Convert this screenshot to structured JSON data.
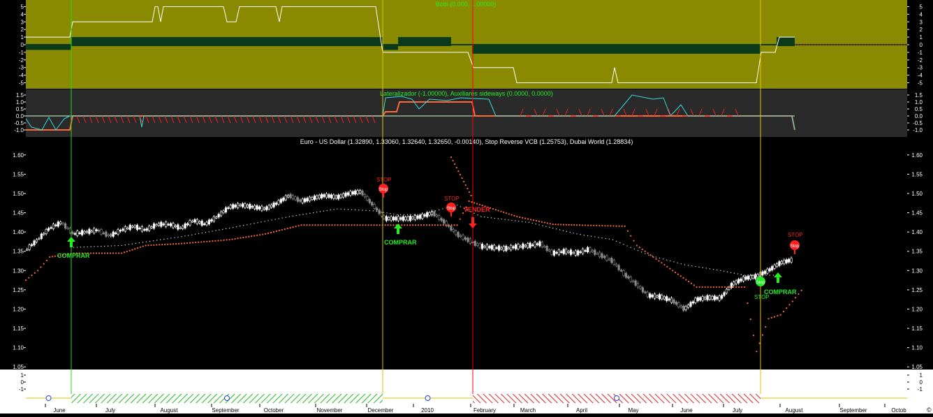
{
  "colors": {
    "upper_bg": "#8a8a00",
    "mid_bg": "#2a2a2a",
    "main_bg": "#000000",
    "white": "#ffffff",
    "green": "#22ee22",
    "red": "#ff2020",
    "orange": "#ff6a3a",
    "cyan": "#33dddd",
    "dark": "#0b3a1a",
    "yellow_line": "#e6c200",
    "green_line": "#22dd22",
    "red_line": "#ff0000"
  },
  "panels": {
    "bobi": {
      "title": "Bobi (0.000, 1.00000)",
      "yticks": [
        "5",
        "4",
        "3",
        "2",
        "1",
        "0",
        "-1",
        "-2",
        "-3",
        "-4",
        "-5"
      ],
      "ylim": [
        -5.5,
        5.5
      ]
    },
    "lateral": {
      "title": "Lateralizador (-1.00000), Auxiliares sideways (0.0000, 0.0000)",
      "yticks": [
        "1.5",
        "1.0",
        "0.5",
        "0.0",
        "-0.5",
        "-1.0"
      ],
      "ylim": [
        -1.4,
        1.8
      ]
    },
    "main": {
      "title": "Euro - US Dollar (1.32890, 1.33060, 1.32640, 1.32650, -0.00140), Stop Reverse VCB (1.25753), Dubai World (1.28834)",
      "yticks": [
        "1.60",
        "1.55",
        "1.50",
        "1.45",
        "1.40",
        "1.35",
        "1.30",
        "1.25",
        "1.20",
        "1.15",
        "1.10",
        "1.05"
      ],
      "ylim": [
        1.045,
        1.645
      ]
    },
    "bottom": {
      "yticks": [
        "1",
        "0",
        "-1"
      ],
      "ylim": [
        -1.5,
        1.6
      ]
    }
  },
  "x_axis": {
    "months": [
      "June",
      "July",
      "August",
      "September",
      "October",
      "November",
      "December",
      "2010",
      "February",
      "March",
      "April",
      "May",
      "June",
      "July",
      "August",
      "September",
      "Octob"
    ],
    "corner_icon": "copyright-icon"
  },
  "signals": {
    "buy1": "COMPRAR",
    "buy2": "COMPRAR",
    "buy3": "COMPRAR",
    "sell": "VENDER",
    "stop1": "STOP",
    "stop2": "STOP",
    "stop3": "STOP",
    "stop4": "STOP",
    "stop_badge": "Stop"
  },
  "regime_bar": [
    {
      "state": "neutral",
      "icon": "smiley-icon"
    },
    {
      "state": "long",
      "icon": "smiley-icon"
    },
    {
      "state": "neutral",
      "icon": "smiley-icon"
    },
    {
      "state": "short",
      "icon": "smiley-icon"
    },
    {
      "state": "neutral",
      "icon": "none"
    }
  ],
  "chart_data": {
    "type": "line",
    "title": "Euro - US Dollar (1.32890, 1.33060, 1.32640, 1.32650, -0.00140), Stop Reverse VCB (1.25753), Dubai World (1.28834)",
    "x_start": "2009-05-18",
    "x_end": "2010-10-15",
    "ylim": [
      1.045,
      1.645
    ],
    "series": [
      {
        "name": "Euro - US Dollar",
        "points": [
          [
            "2009-05-18",
            1.352
          ],
          [
            "2009-05-25",
            1.38
          ],
          [
            "2009-06-01",
            1.41
          ],
          [
            "2009-06-08",
            1.425
          ],
          [
            "2009-06-15",
            1.395
          ],
          [
            "2009-06-22",
            1.4
          ],
          [
            "2009-06-29",
            1.405
          ],
          [
            "2009-07-06",
            1.39
          ],
          [
            "2009-07-13",
            1.405
          ],
          [
            "2009-07-20",
            1.415
          ],
          [
            "2009-07-27",
            1.405
          ],
          [
            "2009-08-03",
            1.42
          ],
          [
            "2009-08-10",
            1.42
          ],
          [
            "2009-08-17",
            1.41
          ],
          [
            "2009-08-24",
            1.43
          ],
          [
            "2009-08-31",
            1.42
          ],
          [
            "2009-09-07",
            1.44
          ],
          [
            "2009-09-14",
            1.465
          ],
          [
            "2009-09-21",
            1.47
          ],
          [
            "2009-09-28",
            1.465
          ],
          [
            "2009-10-05",
            1.46
          ],
          [
            "2009-10-12",
            1.475
          ],
          [
            "2009-10-19",
            1.495
          ],
          [
            "2009-10-26",
            1.48
          ],
          [
            "2009-11-02",
            1.488
          ],
          [
            "2009-11-09",
            1.495
          ],
          [
            "2009-11-16",
            1.49
          ],
          [
            "2009-11-23",
            1.5
          ],
          [
            "2009-11-30",
            1.505
          ],
          [
            "2009-12-07",
            1.47
          ],
          [
            "2009-12-14",
            1.435
          ],
          [
            "2009-12-21",
            1.435
          ],
          [
            "2009-12-28",
            1.435
          ],
          [
            "2010-01-04",
            1.44
          ],
          [
            "2010-01-11",
            1.45
          ],
          [
            "2010-01-18",
            1.425
          ],
          [
            "2010-01-25",
            1.395
          ],
          [
            "2010-02-01",
            1.378
          ],
          [
            "2010-02-08",
            1.363
          ],
          [
            "2010-02-15",
            1.36
          ],
          [
            "2010-02-22",
            1.357
          ],
          [
            "2010-03-01",
            1.362
          ],
          [
            "2010-03-08",
            1.365
          ],
          [
            "2010-03-15",
            1.37
          ],
          [
            "2010-03-22",
            1.345
          ],
          [
            "2010-03-29",
            1.35
          ],
          [
            "2010-04-05",
            1.345
          ],
          [
            "2010-04-12",
            1.355
          ],
          [
            "2010-04-19",
            1.34
          ],
          [
            "2010-04-26",
            1.325
          ],
          [
            "2010-05-03",
            1.29
          ],
          [
            "2010-05-10",
            1.265
          ],
          [
            "2010-05-17",
            1.235
          ],
          [
            "2010-05-24",
            1.232
          ],
          [
            "2010-05-31",
            1.222
          ],
          [
            "2010-06-07",
            1.2
          ],
          [
            "2010-06-14",
            1.225
          ],
          [
            "2010-06-21",
            1.23
          ],
          [
            "2010-06-28",
            1.228
          ],
          [
            "2010-07-05",
            1.265
          ],
          [
            "2010-07-12",
            1.28
          ],
          [
            "2010-07-19",
            1.285
          ],
          [
            "2010-07-26",
            1.3
          ],
          [
            "2010-08-02",
            1.32
          ],
          [
            "2010-08-09",
            1.328
          ]
        ]
      },
      {
        "name": "Stop Reverse VCB",
        "points": [
          [
            "2009-05-18",
            1.275
          ],
          [
            "2009-05-25",
            1.3
          ],
          [
            "2009-06-01",
            1.335
          ],
          [
            "2009-06-15",
            1.345
          ],
          [
            "2009-07-13",
            1.345
          ],
          [
            "2009-07-27",
            1.365
          ],
          [
            "2009-08-17",
            1.37
          ],
          [
            "2009-09-14",
            1.38
          ],
          [
            "2009-10-05",
            1.395
          ],
          [
            "2009-10-26",
            1.418
          ],
          [
            "2009-12-14",
            1.418
          ],
          [
            "2010-01-25",
            1.418
          ],
          [
            "2010-02-01",
            1.48
          ],
          [
            "2010-02-15",
            1.46
          ],
          [
            "2010-03-01",
            1.44
          ],
          [
            "2010-03-22",
            1.42
          ],
          [
            "2010-04-05",
            1.418
          ],
          [
            "2010-05-03",
            1.415
          ],
          [
            "2010-05-10",
            1.365
          ],
          [
            "2010-05-31",
            1.3
          ],
          [
            "2010-06-14",
            1.257
          ],
          [
            "2010-07-12",
            1.257
          ],
          [
            "2010-07-19",
            1.09
          ],
          [
            "2010-07-26",
            1.175
          ],
          [
            "2010-08-02",
            1.185
          ],
          [
            "2010-08-09",
            1.22
          ],
          [
            "2010-08-16",
            1.258
          ]
        ]
      },
      {
        "name": "Dubai World",
        "points": [
          [
            "2009-06-15",
            1.36
          ],
          [
            "2009-07-13",
            1.365
          ],
          [
            "2009-08-17",
            1.388
          ],
          [
            "2009-09-14",
            1.41
          ],
          [
            "2009-10-19",
            1.44
          ],
          [
            "2009-11-16",
            1.46
          ],
          [
            "2009-12-07",
            1.455
          ],
          [
            "2009-12-21",
            1.445
          ],
          [
            "2010-01-04",
            1.445
          ],
          [
            "2010-01-25",
            1.47
          ],
          [
            "2010-02-08",
            1.44
          ],
          [
            "2010-03-08",
            1.425
          ],
          [
            "2010-04-05",
            1.395
          ],
          [
            "2010-04-26",
            1.38
          ],
          [
            "2010-05-17",
            1.34
          ],
          [
            "2010-06-07",
            1.315
          ],
          [
            "2010-06-28",
            1.3
          ],
          [
            "2010-07-12",
            1.288
          ],
          [
            "2010-08-02",
            1.288
          ]
        ]
      }
    ],
    "annotations": [
      {
        "text": "COMPRAR",
        "date": "2009-06-15",
        "value": 1.385,
        "color": "green"
      },
      {
        "text": "COMPRAR",
        "date": "2009-12-21",
        "value": 1.42,
        "color": "green"
      },
      {
        "text": "STOP",
        "date": "2009-12-07",
        "value": 1.51,
        "color": "red"
      },
      {
        "text": "STOP",
        "date": "2010-01-18",
        "value": 1.458,
        "color": "red"
      },
      {
        "text": "VENDER",
        "date": "2010-01-25",
        "value": 1.415,
        "color": "red"
      },
      {
        "text": "STOP",
        "date": "2010-07-26",
        "value": 1.262,
        "color": "green"
      },
      {
        "text": "COMPRAR",
        "date": "2010-08-02",
        "value": 1.265,
        "color": "green"
      },
      {
        "text": "STOP",
        "date": "2010-08-09",
        "value": 1.35,
        "color": "red"
      }
    ]
  }
}
